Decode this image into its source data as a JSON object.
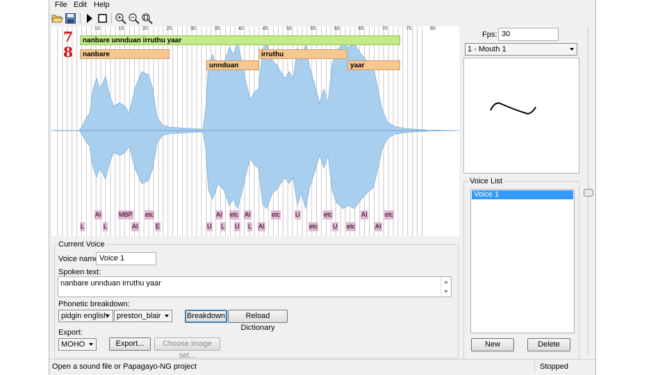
{
  "menu": {
    "file": "File",
    "edit": "Edit",
    "help": "Help"
  },
  "toolbar": {
    "icons": [
      "open-folder-icon",
      "save-icon",
      "play-icon",
      "stop-icon",
      "zoom-in-icon",
      "zoom-out-icon",
      "zoom-fit-icon"
    ]
  },
  "timeline": {
    "ticks": [
      "10",
      "15",
      "20",
      "25",
      "30",
      "35",
      "40",
      "45",
      "50",
      "55",
      "60",
      "65",
      "70",
      "75",
      "80"
    ],
    "row_markers": [
      "7",
      "8"
    ],
    "phrase": "nanbare unnduan irruthu yaar",
    "words": [
      "nanbare",
      "unnduan",
      "irruthu",
      "yaar"
    ],
    "phonemes_top": [
      "AI",
      "MBP",
      "etc",
      "AI",
      "etc",
      "AI",
      "etc",
      "U",
      "etc",
      "AI",
      "etc",
      "AI",
      "etc"
    ],
    "phonemes_bottom": [
      "L",
      "L",
      "AI",
      "E",
      "U",
      "L",
      "U",
      "L",
      "AI",
      "AI",
      "etc",
      "U",
      "etc",
      "AI"
    ]
  },
  "right_panel": {
    "fps_label": "Fps:",
    "fps_value": "30",
    "mouth_select": "1 - Mouth 1",
    "voice_list_title": "Voice List",
    "voices": [
      "Voice 1"
    ],
    "new_button": "New",
    "delete_button": "Delete"
  },
  "current_voice": {
    "title": "Current Voice",
    "voice_name_label": "Voice name:",
    "voice_name_value": "Voice 1",
    "spoken_text_label": "Spoken text:",
    "spoken_text_value": "nanbare unnduan irruthu yaar",
    "phonetic_label": "Phonetic breakdown:",
    "language_select": "pidgin english",
    "phoneme_set_select": "preston_blair",
    "breakdown_button": "Breakdown",
    "reload_button": "Reload Dictionary",
    "export_label": "Export:",
    "export_format": "MOHO",
    "export_button": "Export...",
    "image_set_button": "Choose image set..."
  },
  "status": {
    "message": "Open a sound file or Papagayo-NG project",
    "playback": "Stopped"
  },
  "colors": {
    "waveform": "#a9cfef",
    "phrase": "#c3ea8b",
    "word": "#f5c892",
    "phoneme": "#e4b5d3",
    "selection": "#3399ff"
  }
}
